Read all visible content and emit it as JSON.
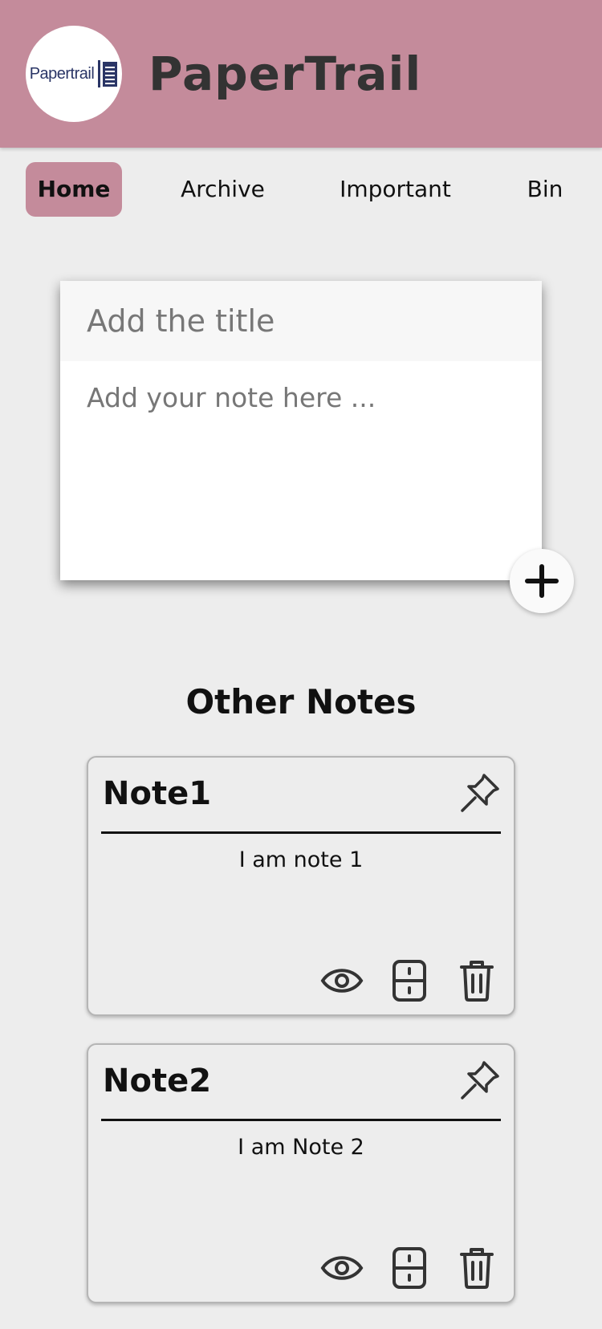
{
  "app": {
    "title": "PaperTrail",
    "logo_text": "Papertrail"
  },
  "nav": {
    "items": [
      {
        "label": "Home",
        "active": true
      },
      {
        "label": "Archive",
        "active": false
      },
      {
        "label": "Important",
        "active": false
      },
      {
        "label": "Bin",
        "active": false
      }
    ]
  },
  "composer": {
    "title_placeholder": "Add the title",
    "body_placeholder": "Add your note here ..."
  },
  "section": {
    "title": "Other Notes"
  },
  "notes": [
    {
      "title": "Note1",
      "text": "I am note 1"
    },
    {
      "title": "Note2",
      "text": "I am Note 2"
    }
  ],
  "icons": {
    "add": "plus-icon",
    "pin": "pin-icon",
    "view": "eye-icon",
    "archive": "archive-icon",
    "delete": "trash-icon"
  },
  "colors": {
    "header": "#c48b9b",
    "background": "#ededed",
    "active_tab": "#c48b9b"
  }
}
